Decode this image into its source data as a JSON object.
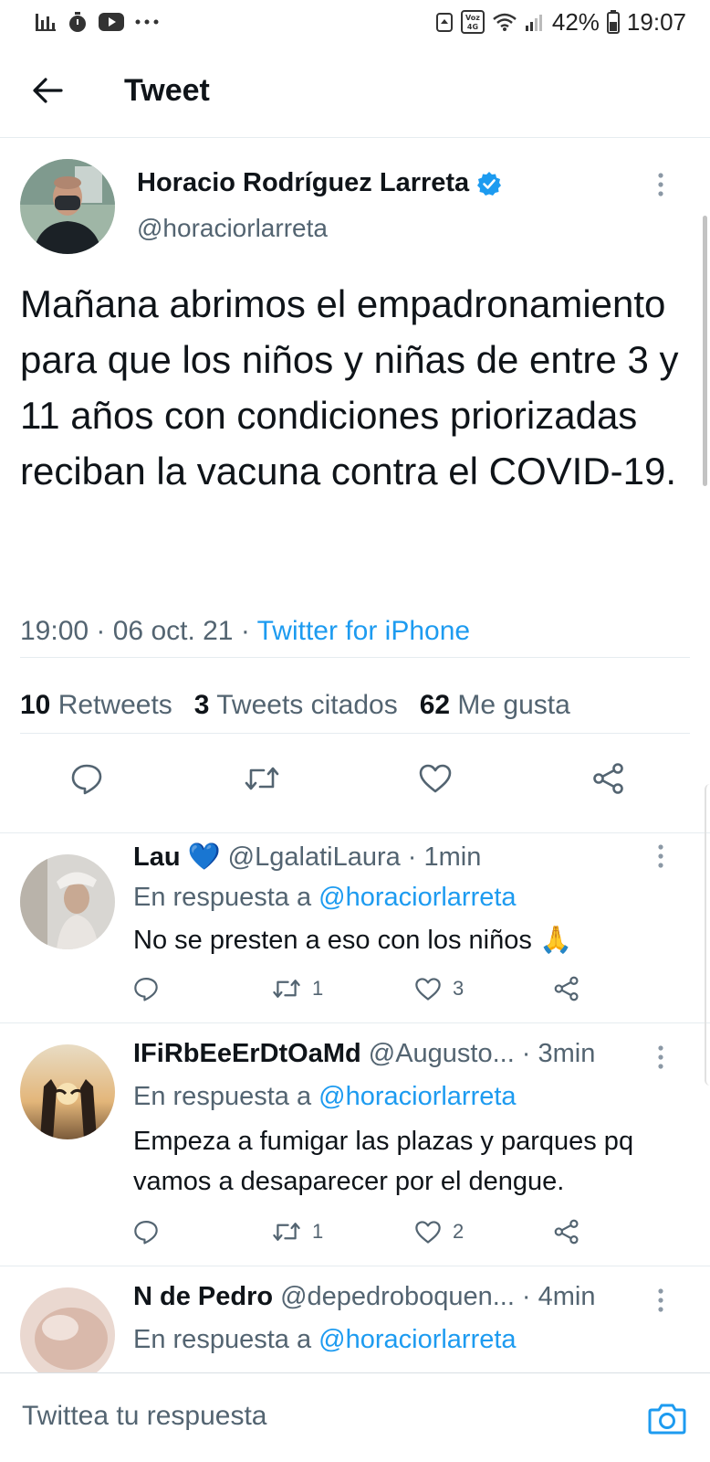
{
  "status_bar": {
    "battery": "42%",
    "time": "19:07",
    "left_icons": [
      "stats-icon",
      "timer-icon",
      "youtube-icon",
      "more-dots"
    ],
    "right_icons": [
      "recycle-icon",
      "volte-4g-icon",
      "wifi-icon",
      "signal-icon",
      "battery-icon"
    ],
    "volte_label": "Voz 4G"
  },
  "header": {
    "title": "Tweet",
    "back_icon": "arrow-left-icon"
  },
  "tweet": {
    "author_name": "Horacio Rodríguez Larreta",
    "handle": "@horaciorlarreta",
    "verified": true,
    "text": "Mañana abrimos el empadronamiento para que los niños y niñas de entre 3 y 11 años con condiciones priorizadas reciban la vacuna contra el COVID-19.",
    "time": "19:00 · 06 oct. 21 · ",
    "source": "Twitter for iPhone",
    "stats": {
      "retweets_count": "10",
      "retweets_label": "Retweets",
      "quotes_count": "3",
      "quotes_label": "Tweets citados",
      "likes_count": "62",
      "likes_label": "Me gusta"
    },
    "actions": [
      "reply-icon",
      "retweet-icon",
      "like-icon",
      "share-icon"
    ]
  },
  "replies": [
    {
      "name": "Lau",
      "emoji": "💙",
      "handle": "@LgalatiLaura",
      "time": "· 1min",
      "in_reply_prefix": "En respuesta a ",
      "in_reply_to": "@horaciorlarreta",
      "text": "No se presten a eso con los niños",
      "text_emoji": "🙏",
      "retweets": "1",
      "likes": "3"
    },
    {
      "name": "IFiRbEeErDtOaMd",
      "handle": "@Augusto...",
      "time": "· 3min",
      "in_reply_prefix": "En respuesta a ",
      "in_reply_to": "@horaciorlarreta",
      "text": "Empeza a fumigar las plazas y parques pq vamos a desaparecer por el dengue.",
      "retweets": "1",
      "likes": "2"
    },
    {
      "name": "N de Pedro",
      "handle": "@depedroboquen...",
      "time": "· 4min",
      "in_reply_prefix": "En respuesta a ",
      "in_reply_to": "@horaciorlarreta"
    }
  ],
  "compose": {
    "placeholder": "Twittea tu respuesta",
    "camera_icon": "camera-icon"
  },
  "colors": {
    "accent": "#1d9bf0",
    "text": "#0f1419",
    "secondary": "#536471",
    "divider": "#e6ecf0"
  }
}
